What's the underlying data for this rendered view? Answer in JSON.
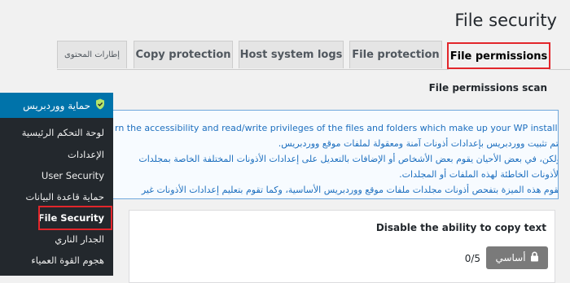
{
  "page": {
    "title": "File security"
  },
  "tabs": [
    {
      "label": "إطارات المحتوى",
      "active": false
    },
    {
      "label": "Copy protection",
      "active": false
    },
    {
      "label": "Host system logs",
      "active": false
    },
    {
      "label": "File protection",
      "active": false
    },
    {
      "label": "File permissions",
      "active": true
    }
  ],
  "scan": {
    "title": "File permissions scan"
  },
  "info": {
    "lines": [
      "rn the accessibility and read/write privileges of the files and folders which make up your WP installation",
      "يتم تثبيت ووردبريس بإعدادات أذونات آمنة ومعقولة لملفات موقع ووردبريس.",
      "ولكن، في بعض الأحيان يقوم بعض الأشخاص أو الإضافات بالتعديل على إعدادات الأذونات المختلفة الخاصة بمجلدات",
      "الأذونات الخاطئة لهذه الملفات أو المجلدات.",
      "تقوم هذه الميزة بتفحص أذونات مجلدات ملفات موقع ووردبريس الأساسية، وكما تقوم بتعليم إعدادات الأذونات غير"
    ]
  },
  "panel": {
    "title": "Disable the ability to copy text",
    "score": "0/5",
    "level": "أساسي"
  },
  "sidebar": {
    "header": "حماية ووردبريس",
    "items": [
      {
        "label": "لوحة التحكم الرئيسية",
        "current": false
      },
      {
        "label": "الإعدادات",
        "current": false
      },
      {
        "label": "User Security",
        "current": false
      },
      {
        "label": "حماية قاعدة البيانات",
        "current": false
      },
      {
        "label": "File Security",
        "current": true
      },
      {
        "label": "الجدار الناري",
        "current": false
      },
      {
        "label": "هجوم القوة العمياء",
        "current": false
      }
    ]
  },
  "icons": {
    "shield": "shield-icon",
    "lock": "lock-icon"
  },
  "colors": {
    "accent": "#0073aa",
    "highlight": "#e2262b",
    "info_text": "#1d6fbf",
    "sidebar_bg": "#23282d"
  }
}
